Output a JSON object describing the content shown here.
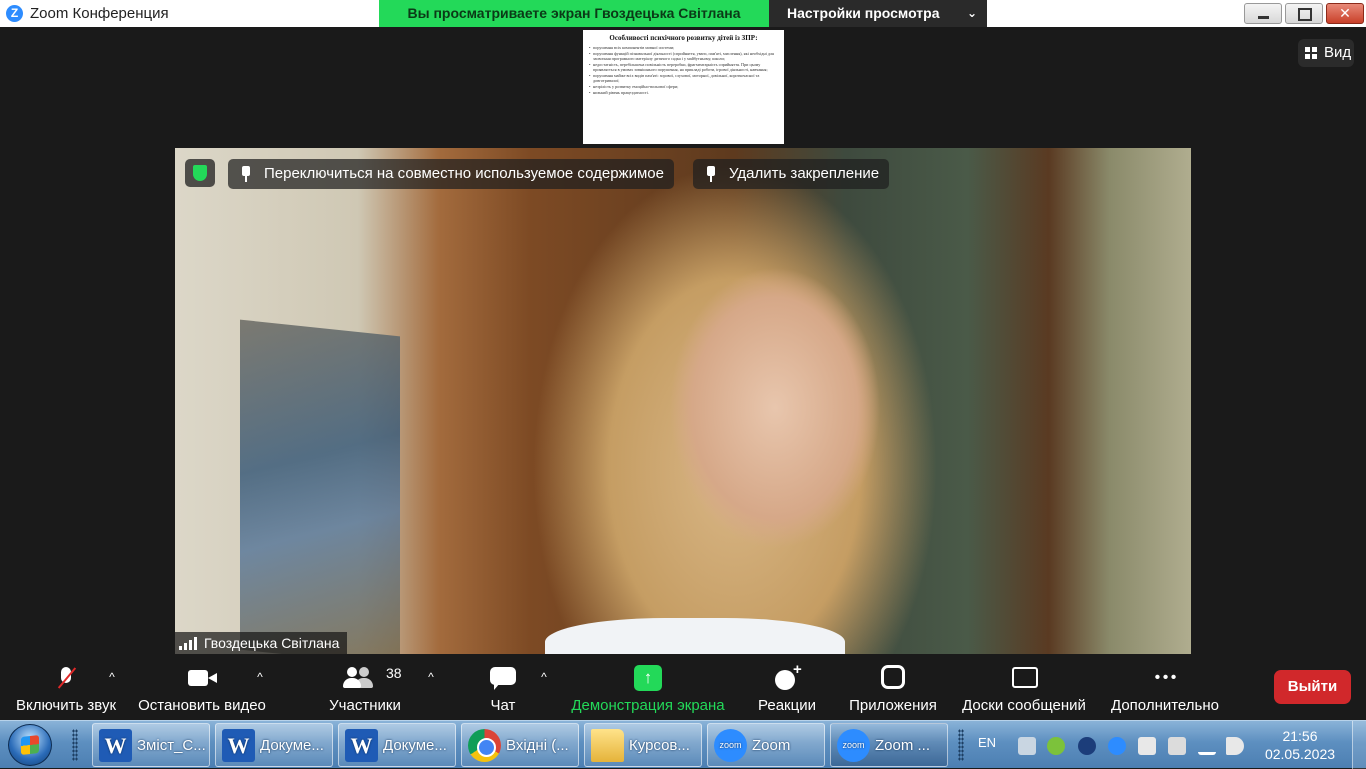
{
  "window": {
    "title": "Zoom Конференция",
    "app_icon": "Z"
  },
  "share_banner": {
    "text": "Вы просматриваете экран Гвоздецька Світлана",
    "view_settings_label": "Настройки просмотра",
    "color": "#23d959"
  },
  "view_button": {
    "label": "Вид"
  },
  "shared_document": {
    "title": "Особливості психічного розвитку дітей із ЗПР:",
    "lines": [
      "порушення всіх компонентів мовної системи;",
      "порушення функцій пізнавальної діяльності (сприйняття, уваги, пам'яті, мислення), які необхідні для засвоєння програмного матеріалу дитячого садка і у майбутньому, школи;",
      "недостатність, перебільшена повільність переробки, фрагментарність сприйняття. При цьому проявляється в умовах зовнішнього порушення, на прикладі роботи, ігрової діяльності, навчання;",
      "порушення майже всіх видів пам'яті: зорової, слухової, моторної, довільної, короткочасної та довготривалої;",
      "незрілість у розвитку емоційно-вольової сфери;",
      "низький рівень працездатності."
    ]
  },
  "video": {
    "switch_label": "Переключиться на совместно используемое содержимое",
    "unpin_label": "Удалить закрепление",
    "participant_name": "Гвоздецька Світлана",
    "security_color": "#23d959"
  },
  "toolbar": {
    "audio_label": "Включить звук",
    "video_label": "Остановить видео",
    "participants_label": "Участники",
    "participants_count": "38",
    "chat_label": "Чат",
    "share_label": "Демонстрация экрана",
    "reactions_label": "Реакции",
    "apps_label": "Приложения",
    "whiteboards_label": "Доски сообщений",
    "more_label": "Дополнительно",
    "leave_label": "Выйти",
    "share_color": "#23d959",
    "leave_color": "#d1282b"
  },
  "taskbar": {
    "tasks": [
      {
        "label": "Зміст_С...",
        "icon": "word-icon"
      },
      {
        "label": "Докуме...",
        "icon": "word-icon"
      },
      {
        "label": "Докуме...",
        "icon": "word-icon"
      },
      {
        "label": "Вхідні (...",
        "icon": "chrome-icon"
      },
      {
        "label": "Курсов...",
        "icon": "folder-icon"
      },
      {
        "label": "Zoom",
        "icon": "zoom-icon"
      },
      {
        "label": "Zoom ...",
        "icon": "zoom-icon"
      }
    ],
    "language": "EN",
    "time": "21:56",
    "date": "02.05.2023"
  }
}
